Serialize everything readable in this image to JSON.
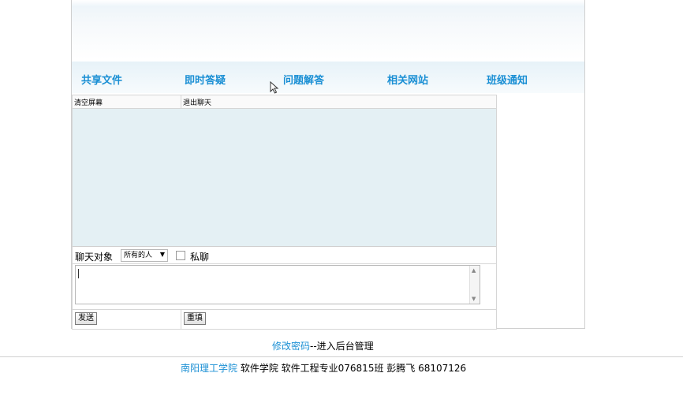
{
  "nav": {
    "items": [
      {
        "label": "共享文件"
      },
      {
        "label": "即时答疑"
      },
      {
        "label": "问题解答"
      },
      {
        "label": "相关网站"
      },
      {
        "label": "班级通知"
      }
    ]
  },
  "chat": {
    "toolbar": {
      "clear_label": "清空屏幕",
      "exit_label": "退出聊天"
    },
    "recipient_label": "聊天对象",
    "recipient_selected": "所有的人",
    "private_label": "私聊",
    "private_checked": false,
    "message_value": "",
    "send_label": "发送",
    "reset_label": "重填"
  },
  "admin": {
    "change_password_label": "修改密码",
    "admin_suffix": "--进入后台管理"
  },
  "footer": {
    "school": "南阳理工学院",
    "text": " 软件学院 软件工程专业076815班 彭腾飞 68107126"
  },
  "colors": {
    "link": "#1a8fd4",
    "chat_bg": "#e4f0f4"
  },
  "icons": {
    "dropdown": "chevron-down-icon",
    "cursor": "mouse-pointer-icon"
  }
}
